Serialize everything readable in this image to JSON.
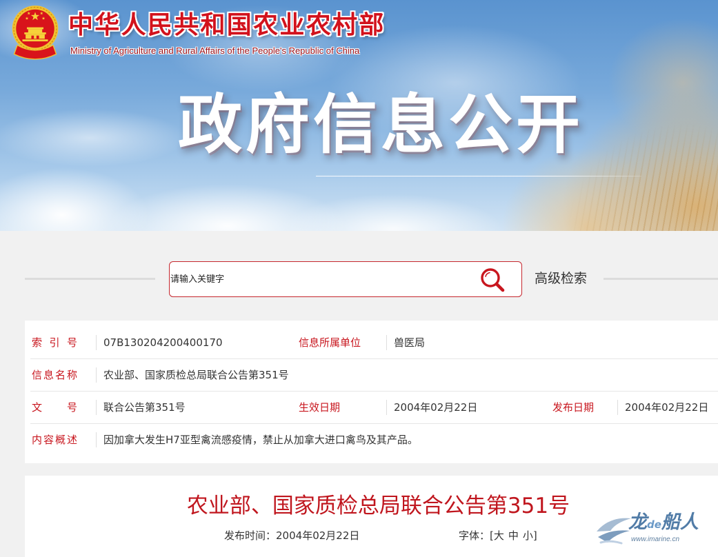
{
  "header": {
    "emblem_icon": "national-emblem-icon",
    "site_title": "中华人民共和国农业农村部",
    "site_subtitle": "Ministry of Agriculture and Rural Affairs of the People's Republic of China",
    "banner_title": "政府信息公开"
  },
  "search": {
    "placeholder": "请输入关键字",
    "search_icon": "search-icon",
    "advanced_label": "高级检索"
  },
  "info_table": {
    "rows": [
      {
        "label": "索 引 号",
        "value": "07B130204200400170",
        "label2": "信息所属单位",
        "value2": "兽医局"
      },
      {
        "label": "信息名称",
        "value": "农业部、国家质检总局联合公告第351号"
      },
      {
        "label": "文　　号",
        "value": "联合公告第351号",
        "label2": "生效日期",
        "value2": "2004年02月22日",
        "label3": "发布日期",
        "value3": "2004年02月22日"
      },
      {
        "label": "内容概述",
        "value": "因加拿大发生H7亚型禽流感疫情，禁止从加拿大进口禽鸟及其产品。"
      }
    ]
  },
  "article": {
    "title": "农业部、国家质检总局联合公告第351号",
    "publish_label": "发布时间：",
    "publish_date": "2004年02月22日",
    "font_label": "字体：",
    "font_open": "[",
    "font_sizes": [
      "大",
      "中",
      "小"
    ],
    "font_close": "]"
  },
  "watermark": {
    "brand_1": "龙",
    "brand_2": "de",
    "brand_3": "船人",
    "url": "www.imarine.cn"
  },
  "colors": {
    "accent_red": "#c4161c",
    "label_red": "#c8161e",
    "text": "#333333",
    "page_background": "#f1f1f1",
    "banner_sky": "#79aadb"
  }
}
